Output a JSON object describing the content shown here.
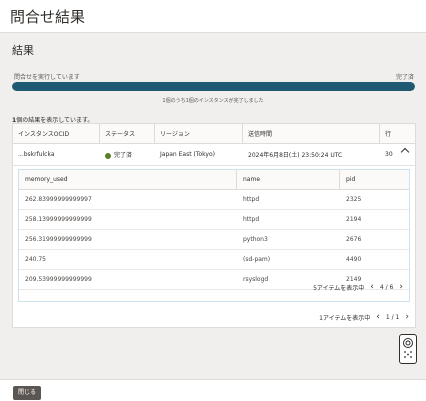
{
  "header": {
    "title": "問合せ結果"
  },
  "section": {
    "title": "結果"
  },
  "progress": {
    "label": "問合せを実行しています",
    "status": "完了済",
    "fraction": 1.0,
    "detail": "1個のうち1個のインスタンスが完了しました",
    "color": "#1f5a73"
  },
  "results": {
    "count_num": "1",
    "count_text": "個の結果を表示しています。",
    "columns": [
      "インスタンスOCID",
      "ステータス",
      "リージョン",
      "送信時間",
      "行"
    ],
    "row": {
      "ocid": "...bskrfulcka",
      "status": "完了済",
      "region": "Japan East (Tokyo)",
      "sent": "2024年6月8日(土) 23:50:24 UTC",
      "rows": "30"
    },
    "status_color": "#5a7f2b"
  },
  "inner": {
    "columns": [
      "memory_used",
      "name",
      "pid"
    ],
    "rows": [
      [
        "262.83999999999997",
        "httpd",
        "2325"
      ],
      [
        "258.13999999999999",
        "httpd",
        "2194"
      ],
      [
        "256.31999999999999",
        "python3",
        "2676"
      ],
      [
        "240.75",
        "(sd-pam)",
        "4490"
      ],
      [
        "209.53999999999999",
        "rsyslogd",
        "2149"
      ]
    ],
    "footer_text": "5アイテムを表示中",
    "page": "4 / 6"
  },
  "outer_footer": {
    "text": "1アイテムを表示中",
    "page": "1 / 1"
  },
  "close_label": "閉じる"
}
